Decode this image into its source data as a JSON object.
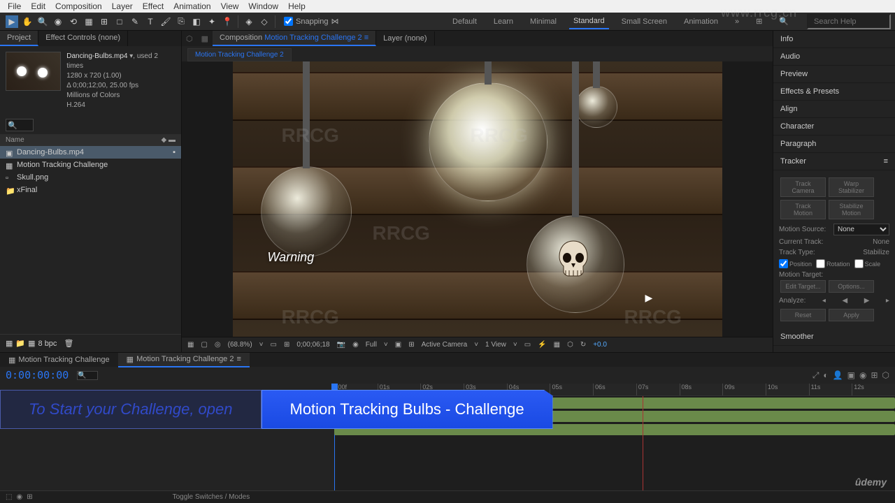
{
  "menu": [
    "File",
    "Edit",
    "Composition",
    "Layer",
    "Effect",
    "Animation",
    "View",
    "Window",
    "Help"
  ],
  "toolbar": {
    "snapping": "Snapping"
  },
  "workspace": {
    "tabs": [
      "Default",
      "Learn",
      "Minimal",
      "Standard",
      "Small Screen",
      "Animation"
    ],
    "active": "Standard",
    "search_placeholder": "Search Help"
  },
  "project": {
    "tabs": {
      "project": "Project",
      "effects": "Effect Controls (none)"
    },
    "asset": {
      "name": "Dancing-Bulbs.mp4",
      "used": ", used 2 times",
      "dims": "1280 x 720 (1.00)",
      "dur": "Δ 0;00;12;00, 25.00 fps",
      "colors": "Millions of Colors",
      "codec": "H.264"
    },
    "list_header": "Name",
    "items": [
      {
        "label": "Dancing-Bulbs.mp4",
        "selected": true
      },
      {
        "label": "Motion Tracking Challenge",
        "selected": false
      },
      {
        "label": "Skull.png",
        "selected": false
      },
      {
        "label": "xFinal",
        "selected": false
      }
    ],
    "bpc": "8 bpc"
  },
  "viewer": {
    "tabs": {
      "comp": "Composition",
      "comp_name": "Motion Tracking Challenge 2",
      "layer": "Layer (none)"
    },
    "flow_tab": "Motion Tracking Challenge 2",
    "overlay_text": "Warning",
    "footer": {
      "zoom": "(68.8%)",
      "time": "0;00;06;18",
      "res": "Full",
      "camera": "Active Camera",
      "views": "1 View",
      "exposure": "+0.0"
    }
  },
  "right_panels": [
    "Info",
    "Audio",
    "Preview",
    "Effects & Presets",
    "Align",
    "Character",
    "Paragraph",
    "Tracker"
  ],
  "tracker": {
    "buttons": {
      "track_camera": "Track Camera",
      "warp": "Warp Stabilizer",
      "track_motion": "Track Motion",
      "stabilize": "Stabilize Motion",
      "edit": "Edit Target...",
      "options": "Options...",
      "reset": "Reset",
      "apply": "Apply"
    },
    "motion_source_label": "Motion Source:",
    "motion_source": "None",
    "current_track_label": "Current Track:",
    "current_track": "None",
    "track_type_label": "Track Type:",
    "track_type": "Stabilize",
    "checks": {
      "position": "Position",
      "rotation": "Rotation",
      "scale": "Scale"
    },
    "motion_target": "Motion Target:",
    "analyze": "Analyze:"
  },
  "smoother": "Smoother",
  "timeline": {
    "tabs": [
      {
        "label": "Motion Tracking Challenge",
        "active": false
      },
      {
        "label": "Motion Tracking Challenge 2",
        "active": true
      }
    ],
    "timecode": "0:00:00:00",
    "ruler": [
      ":00f",
      "01s",
      "02s",
      "03s",
      "04s",
      "05s",
      "06s",
      "07s",
      "08s",
      "09s",
      "10s",
      "11s",
      "12s"
    ]
  },
  "banners": {
    "left": "To Start your Challenge, open",
    "right": "Motion Tracking Bulbs - Challenge"
  },
  "status": "Toggle Switches / Modes",
  "watermark_url": "www.rrcg.cn",
  "watermark_text": "RRCG"
}
